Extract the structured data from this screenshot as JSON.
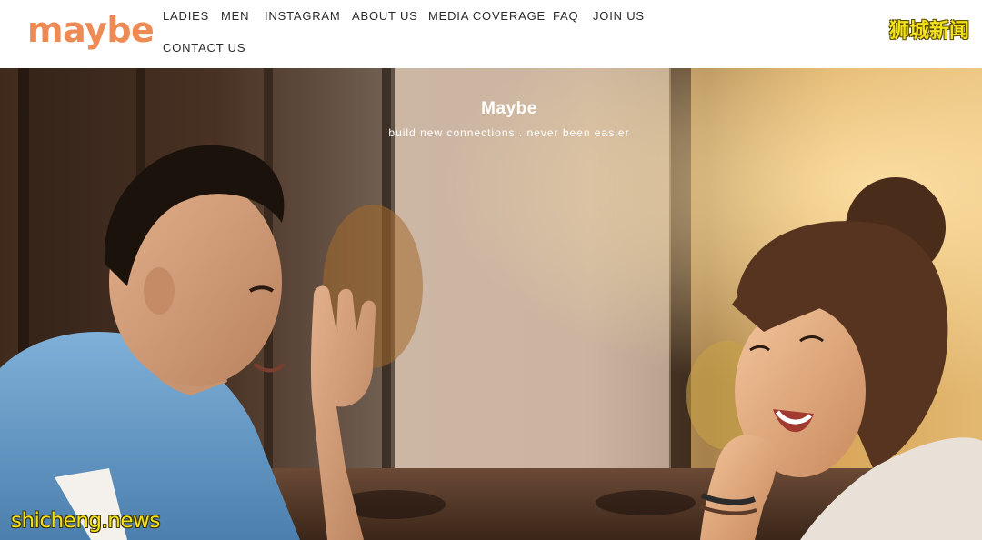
{
  "brand": {
    "logo_text": "maybe",
    "accent_color": "#ee8a54"
  },
  "nav": {
    "items": [
      {
        "label": "LADIES"
      },
      {
        "label": "MEN"
      },
      {
        "label": "INSTAGRAM"
      },
      {
        "label": "ABOUT US"
      },
      {
        "label": "MEDIA COVERAGE"
      },
      {
        "label": "FAQ"
      },
      {
        "label": "JOIN US"
      },
      {
        "label": "CONTACT US"
      }
    ]
  },
  "hero": {
    "title": "Maybe",
    "subtitle": "build new connections . never been easier",
    "image": "photo-couple-laughing-cafe"
  },
  "watermarks": {
    "top_right": "狮城新闻",
    "bottom_left": "shicheng.news",
    "color": "#f2e21a"
  }
}
